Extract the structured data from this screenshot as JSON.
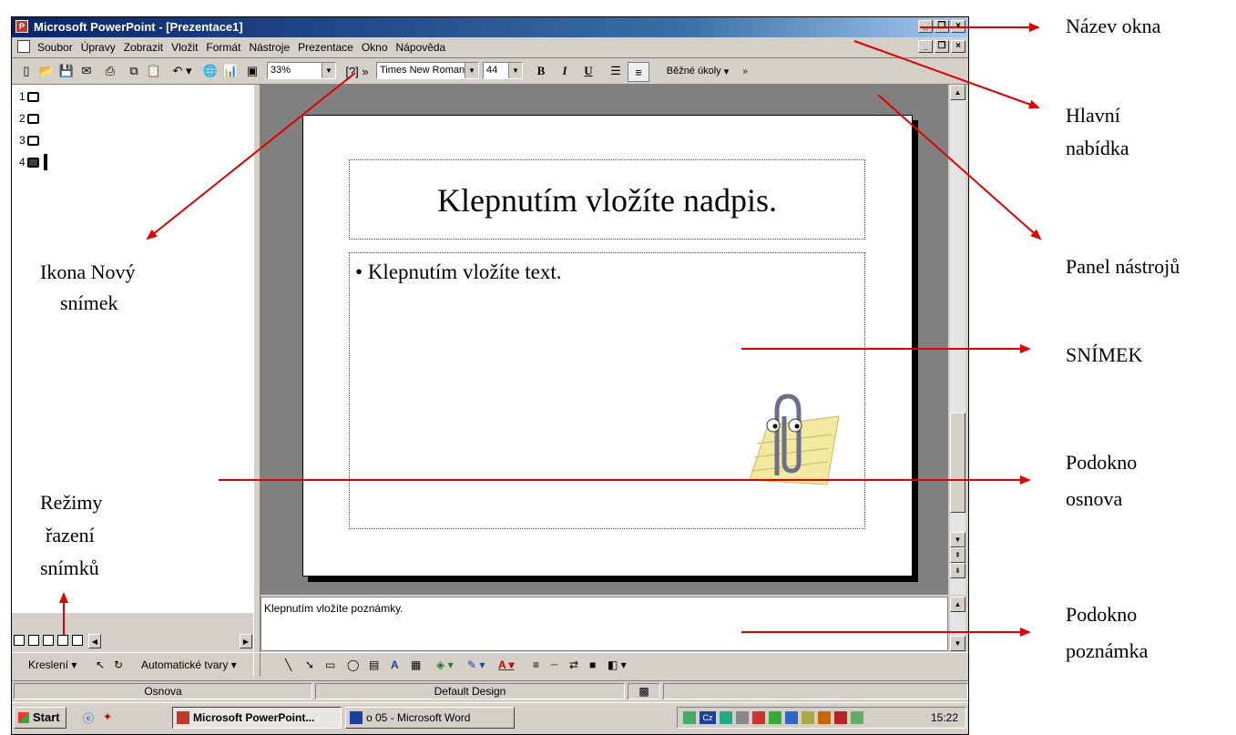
{
  "window": {
    "title": "Microsoft PowerPoint - [Prezentace1]",
    "accent": "#0a246a"
  },
  "menubar": {
    "items": [
      "Soubor",
      "Úpravy",
      "Zobrazit",
      "Vložit",
      "Formát",
      "Nástroje",
      "Prezentace",
      "Okno",
      "Nápověda"
    ]
  },
  "toolbar": {
    "zoom": "33%",
    "font": "Times New Roman",
    "font_size": "44",
    "bold": "B",
    "italic": "I",
    "underline": "U",
    "tasks": "Běžné úkoly"
  },
  "outline": {
    "slides": [
      "1",
      "2",
      "3",
      "4"
    ]
  },
  "slide": {
    "title_placeholder": "Klepnutím vložíte nadpis.",
    "body_placeholder": "Klepnutím vložíte text."
  },
  "notes": {
    "placeholder": "Klepnutím vložíte poznámky."
  },
  "drawing": {
    "draw_menu": "Kreslení",
    "autoshapes": "Automatické tvary"
  },
  "statusbar": {
    "view": "Osnova",
    "design": "Default Design"
  },
  "taskbar": {
    "start": "Start",
    "tasks": [
      "Microsoft PowerPoint...",
      "o 05 - Microsoft Word"
    ],
    "clock": "15:22",
    "lang": "Cz"
  },
  "annotations": {
    "title_bar": "Název okna",
    "main_menu_1": "Hlavní",
    "main_menu_2": "nabídka",
    "toolbar_1": "Panel nástrojů",
    "new_slide_1": "Ikona Nový",
    "new_slide_2": "snímek",
    "slide": "SNÍMEK",
    "outline_1": "Podokno",
    "outline_2": "osnova",
    "views_1": "Režimy",
    "views_2": "řazení",
    "views_3": "snímků",
    "notes_1": "Podokno",
    "notes_2": "poznámka",
    "arrow_color": "#e00000"
  }
}
